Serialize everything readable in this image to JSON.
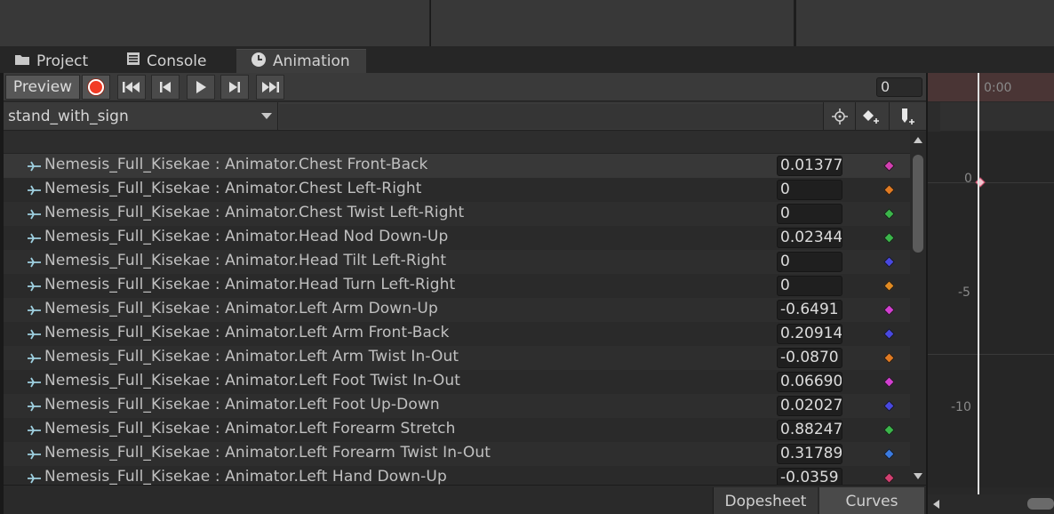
{
  "tabs": [
    {
      "label": "Project",
      "icon": "folder-icon"
    },
    {
      "label": "Console",
      "icon": "console-icon"
    },
    {
      "label": "Animation",
      "icon": "clock-icon",
      "active": true
    }
  ],
  "toolbar": {
    "preview_label": "Preview",
    "record_icon": "record-icon",
    "frame_value": "0"
  },
  "clip": {
    "selected": "stand_with_sign"
  },
  "properties": [
    {
      "label": "Nemesis_Full_Kisekae : Animator.Chest Front-Back",
      "value": "0.01377",
      "key_color": "#d23fb0",
      "selected": true
    },
    {
      "label": "Nemesis_Full_Kisekae : Animator.Chest Left-Right",
      "value": "0",
      "key_color": "#e07a22"
    },
    {
      "label": "Nemesis_Full_Kisekae : Animator.Chest Twist Left-Right",
      "value": "0",
      "key_color": "#3bb54a"
    },
    {
      "label": "Nemesis_Full_Kisekae : Animator.Head Nod Down-Up",
      "value": "0.02344",
      "key_color": "#3bb54a"
    },
    {
      "label": "Nemesis_Full_Kisekae : Animator.Head Tilt Left-Right",
      "value": "0",
      "key_color": "#4848e0"
    },
    {
      "label": "Nemesis_Full_Kisekae : Animator.Head Turn Left-Right",
      "value": "0",
      "key_color": "#e08a22"
    },
    {
      "label": "Nemesis_Full_Kisekae : Animator.Left Arm Down-Up",
      "value": "-0.6491",
      "key_color": "#d23fd0"
    },
    {
      "label": "Nemesis_Full_Kisekae : Animator.Left Arm Front-Back",
      "value": "0.20914",
      "key_color": "#4848e0"
    },
    {
      "label": "Nemesis_Full_Kisekae : Animator.Left Arm Twist In-Out",
      "value": "-0.0870",
      "key_color": "#e07a22"
    },
    {
      "label": "Nemesis_Full_Kisekae : Animator.Left Foot Twist In-Out",
      "value": "0.06690",
      "key_color": "#d23fd0"
    },
    {
      "label": "Nemesis_Full_Kisekae : Animator.Left Foot Up-Down",
      "value": "0.02027",
      "key_color": "#4848e0"
    },
    {
      "label": "Nemesis_Full_Kisekae : Animator.Left Forearm Stretch",
      "value": "0.88247",
      "key_color": "#3bb54a"
    },
    {
      "label": "Nemesis_Full_Kisekae : Animator.Left Forearm Twist In-Out",
      "value": "0.31789",
      "key_color": "#3a7ae0"
    },
    {
      "label": "Nemesis_Full_Kisekae : Animator.Left Hand Down-Up",
      "value": "-0.0359",
      "key_color": "#d23f70"
    }
  ],
  "bottom": {
    "dopesheet_label": "Dopesheet",
    "curves_label": "Curves"
  },
  "timeline": {
    "time_label": "0:00",
    "axis": [
      "0",
      "-5",
      "-10"
    ]
  }
}
